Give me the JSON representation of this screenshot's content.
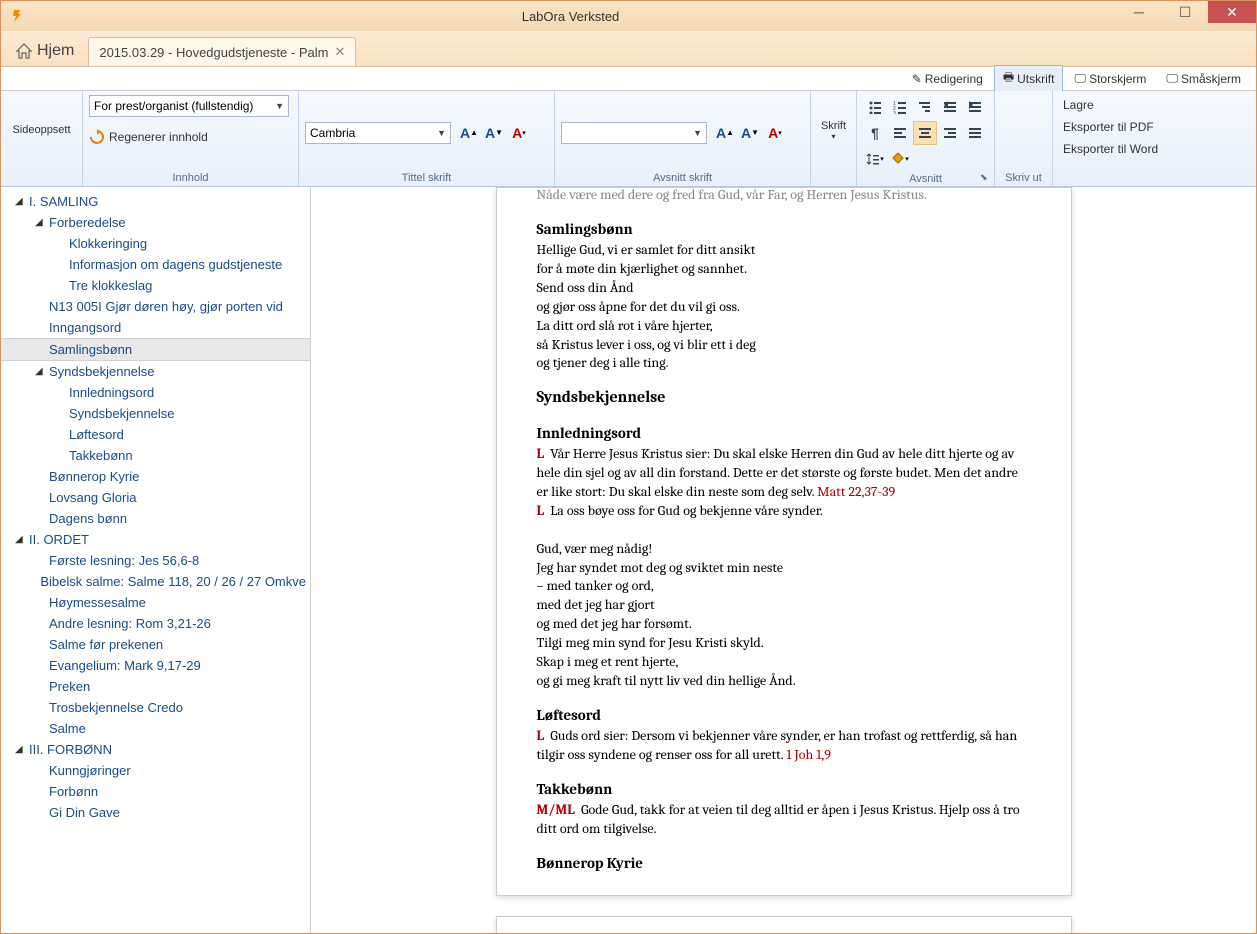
{
  "titlebar": {
    "title": "LabOra Verksted"
  },
  "tabs": {
    "home": "Hjem",
    "doc": "2015.03.29 - Hovedgudstjeneste - Palm"
  },
  "modes": {
    "redigering": "Redigering",
    "utskrift": "Utskrift",
    "storskjerm": "Storskjerm",
    "smaskjerm": "Småskjerm"
  },
  "ribbon": {
    "sideoppsett": "Sideoppsett",
    "preset": "For prest/organist (fullstendig)",
    "regen": "Regenerer innhold",
    "innhold": "Innhold",
    "font": "Cambria",
    "tittel_skrift": "Tittel skrift",
    "avsnitt_skrift": "Avsnitt skrift",
    "skrift": "Skrift",
    "avsnitt": "Avsnitt",
    "skriv_ut": "Skriv ut",
    "lagre": "Lagre",
    "eks_pdf": "Eksporter til PDF",
    "eks_word": "Eksporter til Word"
  },
  "tree": [
    {
      "lvl": 0,
      "exp": "▾",
      "label": "I. SAMLING"
    },
    {
      "lvl": 1,
      "exp": "▾",
      "label": "Forberedelse"
    },
    {
      "lvl": 2,
      "exp": "",
      "label": "Klokkeringing"
    },
    {
      "lvl": 2,
      "exp": "",
      "label": "Informasjon om dagens gudstjeneste"
    },
    {
      "lvl": 2,
      "exp": "",
      "label": "Tre klokkeslag"
    },
    {
      "lvl": 1,
      "exp": "",
      "label": "N13 005I  Gjør døren høy, gjør porten vid"
    },
    {
      "lvl": 1,
      "exp": "",
      "label": "Inngangsord"
    },
    {
      "lvl": 1,
      "exp": "",
      "label": "Samlingsbønn",
      "sel": true
    },
    {
      "lvl": 1,
      "exp": "▾",
      "label": "Syndsbekjennelse"
    },
    {
      "lvl": 2,
      "exp": "",
      "label": "Innledningsord"
    },
    {
      "lvl": 2,
      "exp": "",
      "label": "Syndsbekjennelse"
    },
    {
      "lvl": 2,
      "exp": "",
      "label": "Løftesord"
    },
    {
      "lvl": 2,
      "exp": "",
      "label": "Takkebønn"
    },
    {
      "lvl": 1,
      "exp": "",
      "label": "Bønnerop Kyrie"
    },
    {
      "lvl": 1,
      "exp": "",
      "label": "Lovsang Gloria"
    },
    {
      "lvl": 1,
      "exp": "",
      "label": "Dagens bønn"
    },
    {
      "lvl": 0,
      "exp": "▾",
      "label": "II. ORDET"
    },
    {
      "lvl": 1,
      "exp": "",
      "label": "Første lesning: Jes 56,6-8"
    },
    {
      "lvl": 1,
      "exp": "",
      "label": "Bibelsk salme: Salme 118, 20 / 26 / 27 Omkve"
    },
    {
      "lvl": 1,
      "exp": "",
      "label": "Høymessesalme"
    },
    {
      "lvl": 1,
      "exp": "",
      "label": "Andre lesning: Rom 3,21-26"
    },
    {
      "lvl": 1,
      "exp": "",
      "label": "Salme før prekenen"
    },
    {
      "lvl": 1,
      "exp": "",
      "label": "Evangelium: Mark 9,17-29"
    },
    {
      "lvl": 1,
      "exp": "",
      "label": "Preken"
    },
    {
      "lvl": 1,
      "exp": "",
      "label": "Trosbekjennelse Credo"
    },
    {
      "lvl": 1,
      "exp": "",
      "label": "Salme"
    },
    {
      "lvl": 0,
      "exp": "▾",
      "label": "III. FORBØNN"
    },
    {
      "lvl": 1,
      "exp": "",
      "label": "Kunngjøringer"
    },
    {
      "lvl": 1,
      "exp": "",
      "label": "Forbønn"
    },
    {
      "lvl": 1,
      "exp": "",
      "label": "Gi Din Gave"
    }
  ],
  "doc": {
    "cut_top": "Nåde være med dere og fred fra Gud, vår Far, og Herren Jesus Kristus.",
    "h_samlingsbonn": "Samlingsbønn",
    "samlingsbonn": [
      "Hellige Gud, vi er samlet for ditt ansikt",
      "for å møte din kjærlighet og sannhet.",
      "Send oss din Ånd",
      "og gjør oss åpne for det du vil gi oss.",
      "La ditt ord slå rot i våre hjerter,",
      "så Kristus lever i oss, og vi blir ett i deg",
      "og tjener deg i alle ting."
    ],
    "h_synds": "Syndsbekjennelse",
    "h_innledning": "Innledningsord",
    "l1_prefix": "L",
    "l1": "Vår Herre Jesus Kristus sier: Du skal elske Herren din Gud av hele ditt hjerte og av hele din sjel og av all din forstand. Dette er det største og første budet. Men det andre er like stort: Du skal elske din neste som deg selv.",
    "l1_ref": "Matt 22,37-39",
    "l2_prefix": "L",
    "l2": "La oss bøye oss for Gud og bekjenne våre synder.",
    "confession": [
      "Gud, vær meg nådig!",
      "Jeg har syndet mot deg og sviktet min neste",
      "– med tanker og ord,",
      "med det jeg har gjort",
      "og med det jeg har forsømt.",
      "Tilgi meg min synd for Jesu Kristi skyld.",
      "Skap i meg et rent hjerte,",
      "og gi meg kraft til nytt liv ved din hellige Ånd."
    ],
    "h_loftesord": "Løftesord",
    "l3_prefix": "L",
    "l3": "Guds ord sier: Dersom vi bekjenner våre synder, er han trofast og rettferdig, så han tilgir oss syndene og renser oss for all urett.",
    "l3_ref": "1 Joh 1,9",
    "h_takkebonn": "Takkebønn",
    "mml_prefix": "M/ML",
    "mml": "Gode Gud, takk for at veien til deg alltid er åpen i Jesus Kristus. Hjelp oss å tro ditt ord om tilgivelse.",
    "h_kyrie": "Bønnerop Kyrie"
  }
}
